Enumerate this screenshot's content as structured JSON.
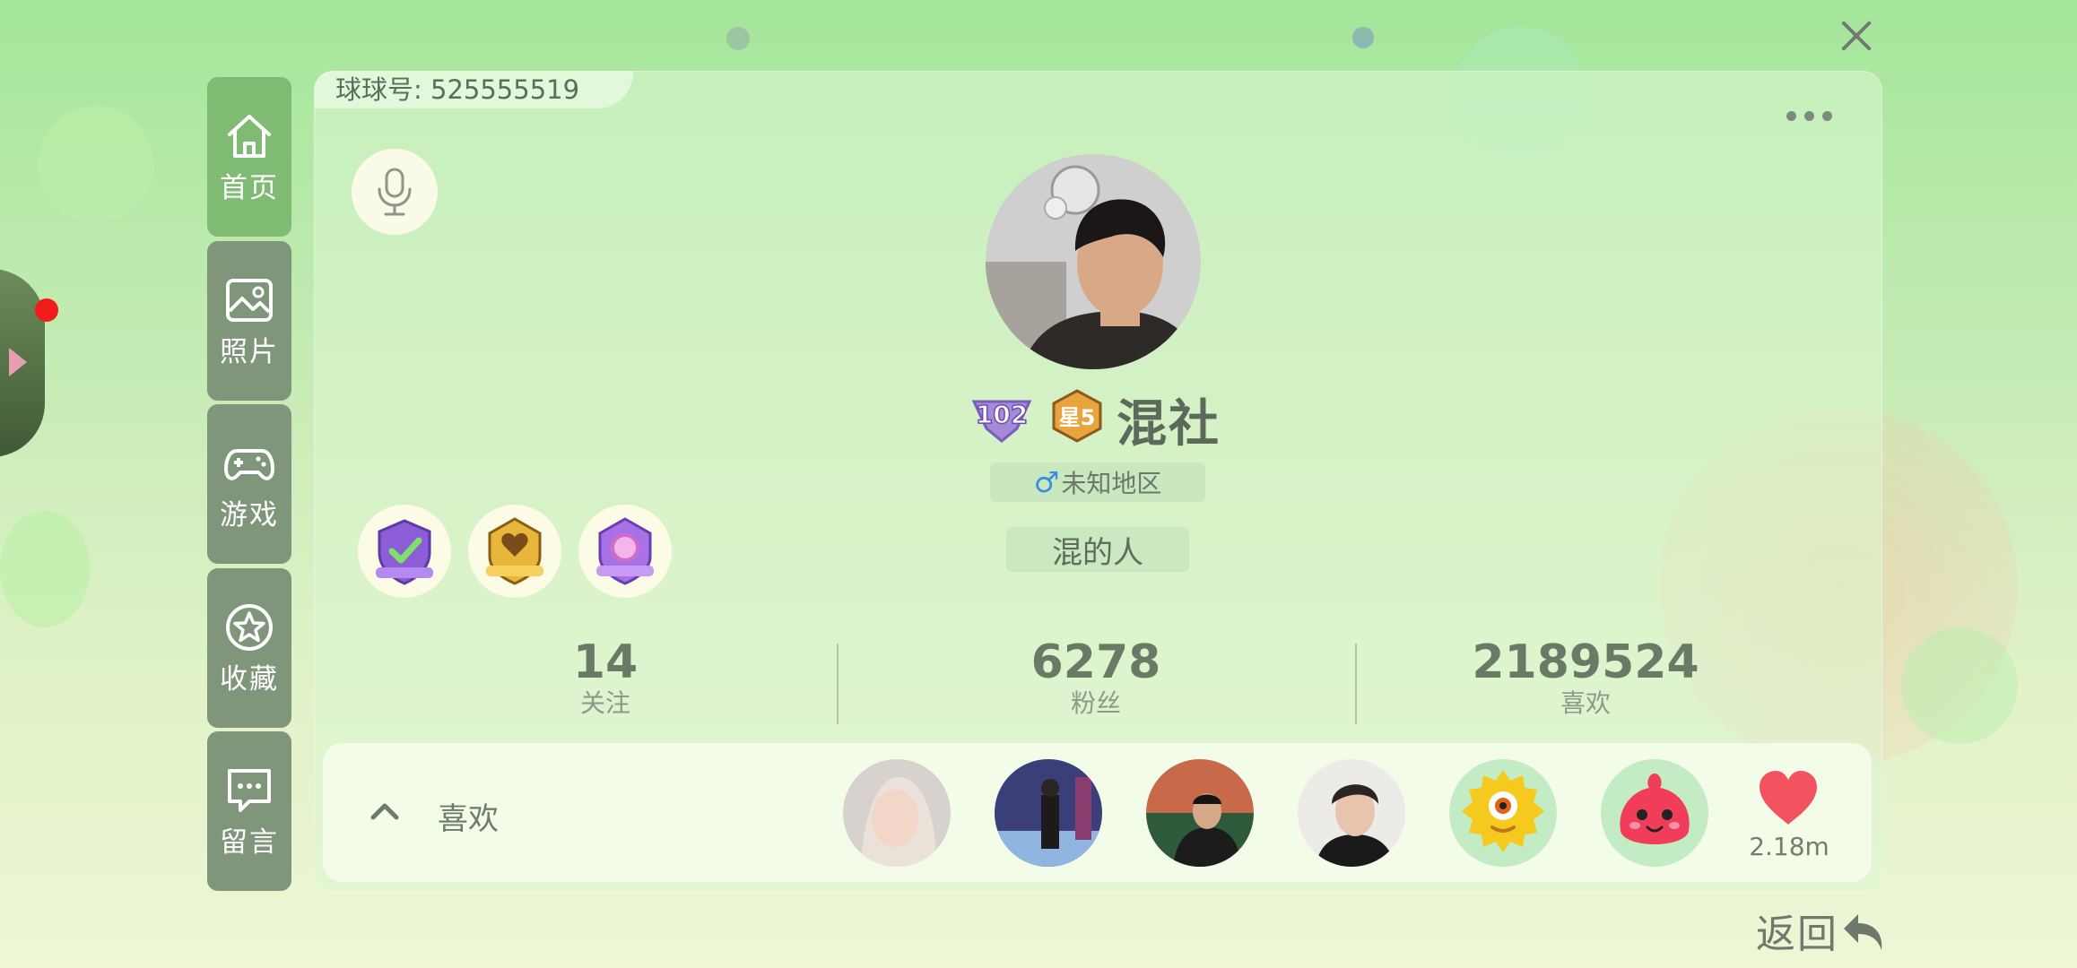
{
  "header": {
    "uid_text": "球球号: 525555519"
  },
  "nav": [
    {
      "label": "首页",
      "icon": "home-icon",
      "active": true
    },
    {
      "label": "照片",
      "icon": "photo-icon",
      "active": false
    },
    {
      "label": "游戏",
      "icon": "gamepad-icon",
      "active": false
    },
    {
      "label": "收藏",
      "icon": "star-icon",
      "active": false
    },
    {
      "label": "留言",
      "icon": "message-icon",
      "active": false
    }
  ],
  "profile": {
    "level": "102",
    "star_badge": "星5",
    "name": "混社",
    "gender_symbol": "♂",
    "region": "未知地区",
    "signature": "混的人"
  },
  "stats": [
    {
      "value": "14",
      "label": "关注"
    },
    {
      "value": "6278",
      "label": "粉丝"
    },
    {
      "value": "2189524",
      "label": "喜欢"
    }
  ],
  "likes": {
    "label": "喜欢",
    "count": "2.18m"
  },
  "footer": {
    "back_label": "返回"
  },
  "colors": {
    "accent_nav": "#7fbb72",
    "nav": "#80967a",
    "heart": "#f3535e"
  }
}
